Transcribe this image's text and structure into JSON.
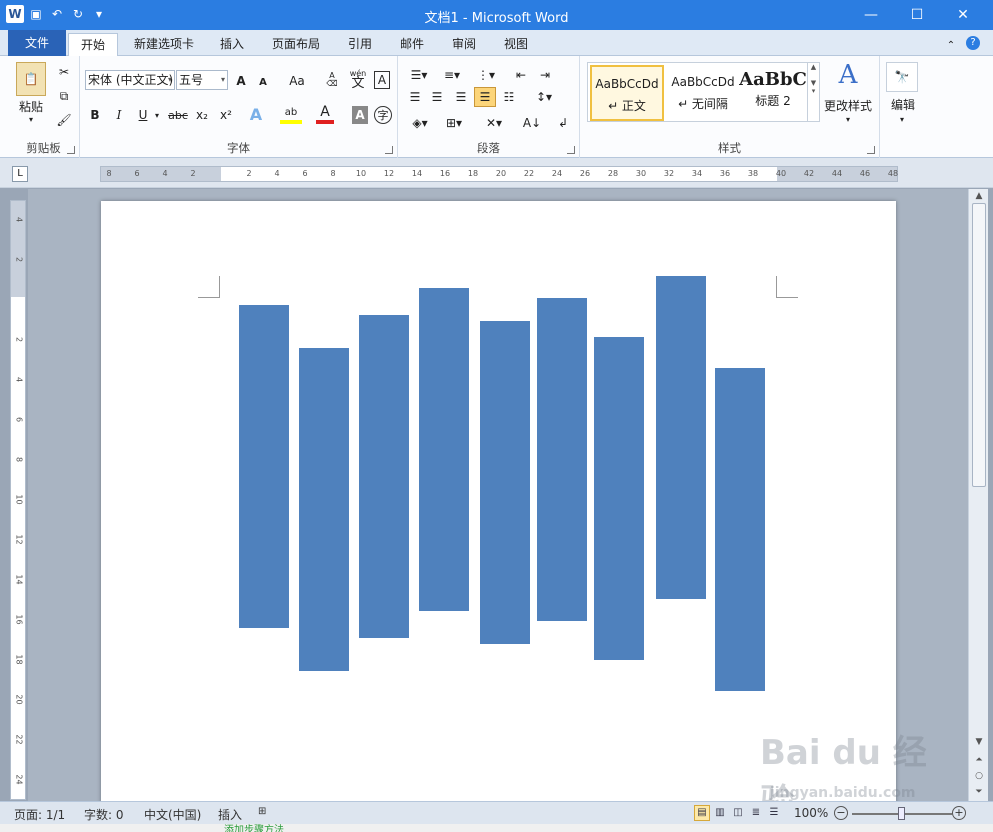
{
  "window": {
    "title": "文档1 - Microsoft Word",
    "app_icon": "W",
    "controls": [
      "minimize-icon",
      "maximize-icon",
      "close-icon"
    ]
  },
  "quick_access": [
    "save-icon",
    "undo-icon",
    "redo-icon",
    "customize-icon"
  ],
  "tabs": [
    {
      "label": "文件"
    },
    {
      "label": "开始"
    },
    {
      "label": "新建选项卡"
    },
    {
      "label": "插入"
    },
    {
      "label": "页面布局"
    },
    {
      "label": "引用"
    },
    {
      "label": "邮件"
    },
    {
      "label": "审阅"
    },
    {
      "label": "视图"
    }
  ],
  "ribbon": {
    "clipboard": {
      "label": "剪贴板",
      "paste": "粘贴"
    },
    "font": {
      "label": "字体",
      "font_name": "宋体 (中文正文)",
      "font_size": "五号",
      "case": "Aa",
      "bold": "B",
      "italic": "I",
      "underline": "U",
      "strike": "abc",
      "subscript": "x₂",
      "superscript": "x²",
      "effects": "A",
      "highlight": "ab",
      "color": "A",
      "shade": "A",
      "enclose": "字",
      "grow": "A",
      "shrink": "A",
      "pinyin": "wén",
      "pinyin_char": "文",
      "border": "A"
    },
    "paragraph": {
      "label": "段落"
    },
    "styles": {
      "label": "样式",
      "items": [
        {
          "sample": "AaBbCcDd",
          "name": "↵ 正文"
        },
        {
          "sample": "AaBbCcDd",
          "name": "↵ 无间隔"
        },
        {
          "sample": "AaBbC",
          "name": "标题 2"
        }
      ],
      "change": "更改样式"
    },
    "editing": {
      "label": "编辑"
    }
  },
  "ruler": {
    "hticks": [
      "8",
      "6",
      "4",
      "2",
      "",
      "2",
      "4",
      "6",
      "8",
      "10",
      "12",
      "14",
      "16",
      "18",
      "20",
      "22",
      "24",
      "26",
      "28",
      "30",
      "32",
      "34",
      "36",
      "38",
      "40",
      "42",
      "44",
      "46",
      "48"
    ],
    "vticks": [
      "4",
      "2",
      "",
      "2",
      "4",
      "6",
      "8",
      "10",
      "12",
      "14",
      "16",
      "18",
      "20",
      "22",
      "24"
    ]
  },
  "document": {
    "shape_color": "#4f81bd",
    "columns": 9
  },
  "status": {
    "page": "页面: 1/1",
    "words": "字数: 0",
    "language": "中文(中国)",
    "mode": "插入",
    "zoom": "100%"
  },
  "watermark": {
    "text": "Bai du 经验",
    "url": "jingyan.baidu.com"
  },
  "partial_link": "添加步骤方法"
}
